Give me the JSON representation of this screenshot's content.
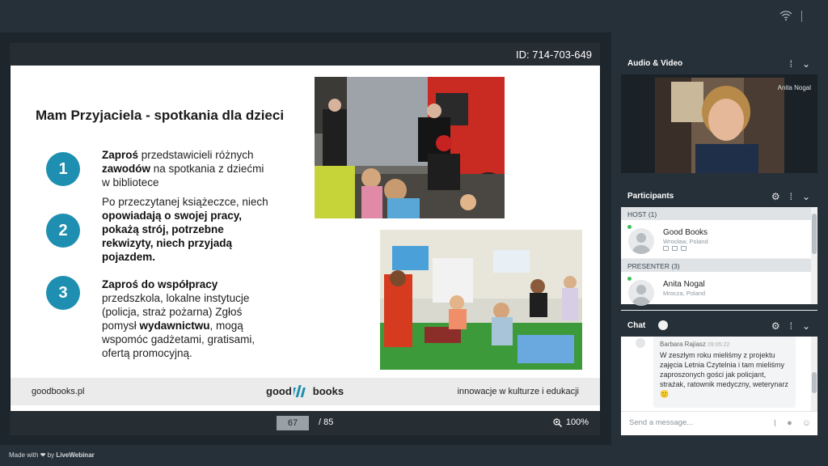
{
  "presentation": {
    "id_label": "ID: 714-703-649",
    "page_current": "67",
    "page_total": "/ 85",
    "zoom": "100%"
  },
  "slide": {
    "title": "Mam Przyjaciela - spotkania dla dzieci",
    "steps": [
      {
        "number": "1"
      },
      {
        "number": "2"
      },
      {
        "number": "3"
      }
    ],
    "step1": {
      "b1": "Zaproś",
      "t1": " przedstawicieli różnych ",
      "b2": "zawodów",
      "t2": " na spotkania z dziećmi w bibliotece"
    },
    "step2": {
      "t1": "Po przeczytanej książeczce, niech ",
      "b1": "opowiadają o swojej pracy, pokażą strój, potrzebne rekwizyty, niech przyjadą pojazdem."
    },
    "step3": {
      "b1": "Zaproś do współpracy",
      "t1": " przedszkola, lokalne instytucje (policja, straż pożarna) Zgłoś pomysł ",
      "b2": "wydawnictwu",
      "t2": ", mogą wspomóc gadżetami, gratisami, ofertą promocyjną."
    },
    "footer_left": "goodbooks.pl",
    "logo_left": "good",
    "logo_right": "books",
    "footer_right": "innowacje w kulturze i edukacji"
  },
  "audio_video": {
    "title": "Audio & Video",
    "presenter_name": "Anita Nogal"
  },
  "participants": {
    "title": "Participants",
    "host_header": "HOST (1)",
    "presenter_header": "PRESENTER (3)",
    "host": {
      "name": "Good Books",
      "location": "Wrocław, Poland"
    },
    "presenter": {
      "name": "Anita Nogal",
      "location": "Mrocza, Poland"
    }
  },
  "chat": {
    "title": "Chat",
    "sender": "Barbara Rajiasz",
    "time": "09:05:22",
    "message": "W zeszłym roku mieliśmy z projektu zajęcia Letnia Czytelnia i tam mieliśmy zaproszonych gości jak policjant, strażak, ratownik medyczny, weterynarz 🙂",
    "placeholder": "Send a message..."
  },
  "footer": {
    "made_with": "Made with",
    "by": "by",
    "brand": "LiveWebinar"
  },
  "colors": {
    "accent": "#1e8fb0",
    "background": "#263038",
    "online": "#3fbf5b"
  }
}
